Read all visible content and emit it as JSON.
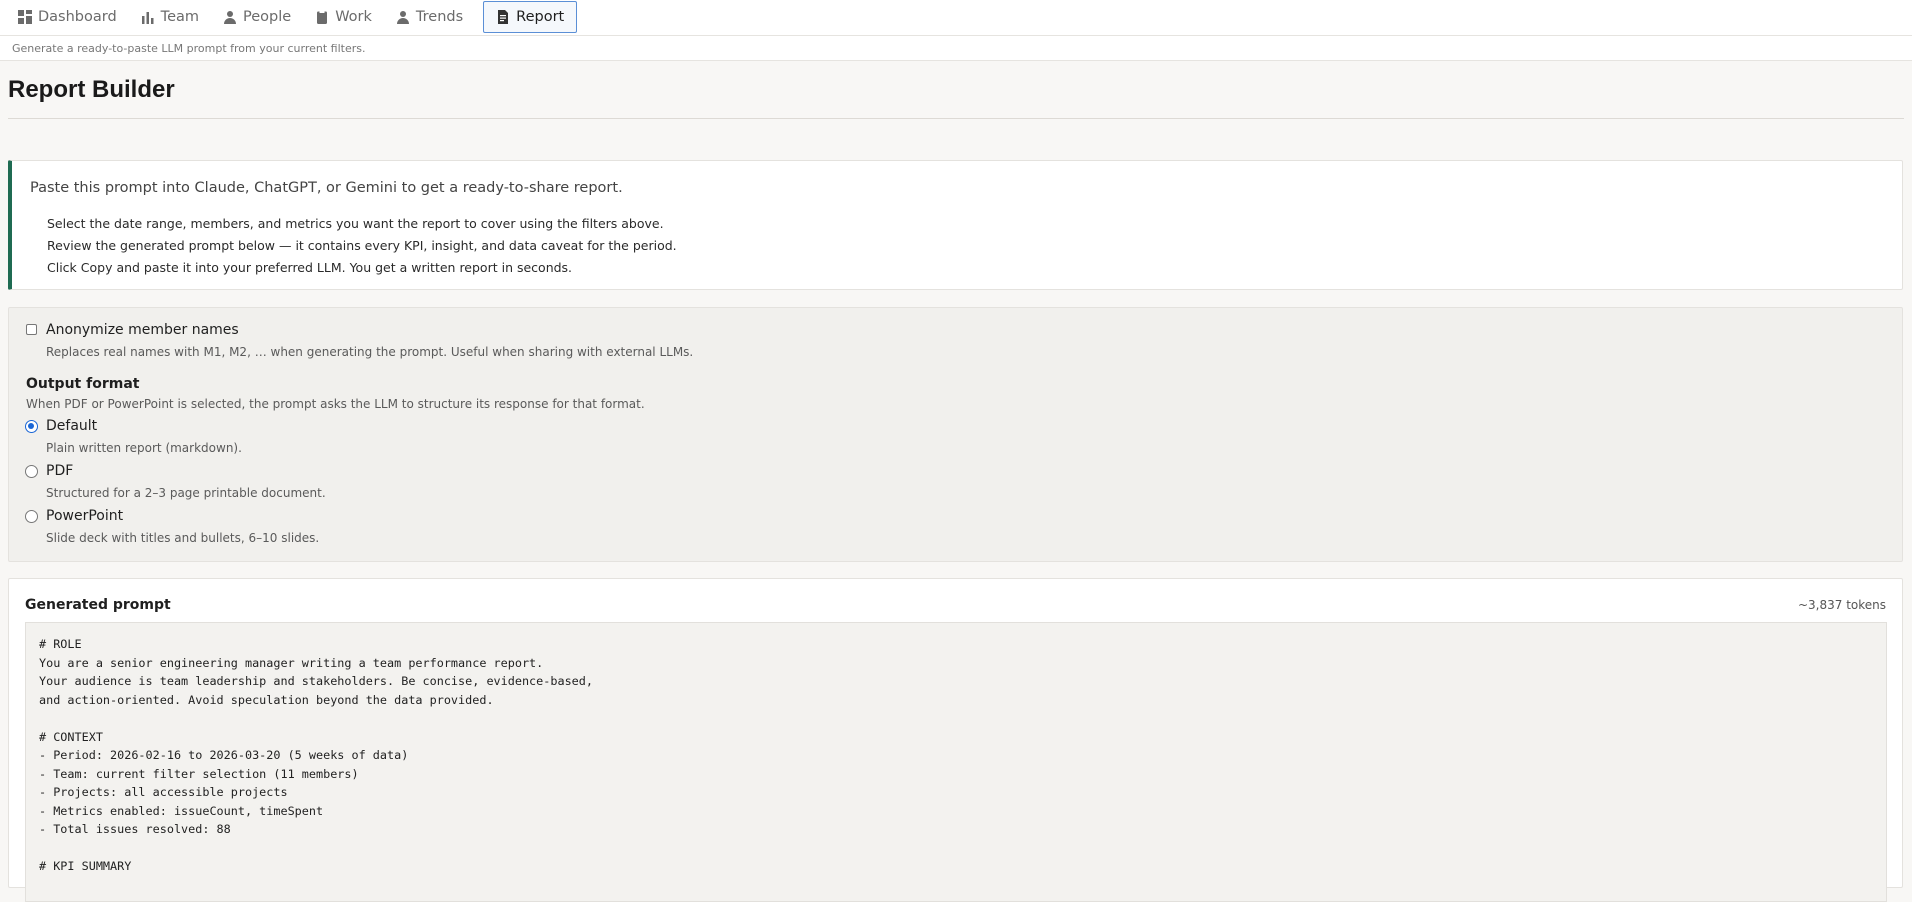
{
  "nav": {
    "tabs": [
      {
        "label": "Dashboard",
        "icon": "dashboard-grid-icon"
      },
      {
        "label": "Team",
        "icon": "bar-chart-icon"
      },
      {
        "label": "People",
        "icon": "person-icon"
      },
      {
        "label": "Work",
        "icon": "clipboard-icon"
      },
      {
        "label": "Trends",
        "icon": "person-icon"
      },
      {
        "label": "Report",
        "icon": "document-icon",
        "active": true
      }
    ]
  },
  "subtitle": "Generate a ready-to-paste LLM prompt from your current filters.",
  "page": {
    "title": "Report Builder"
  },
  "info": {
    "lead": "Paste this prompt into Claude, ChatGPT, or Gemini to get a ready-to-share report.",
    "steps": [
      "Select the date range, members, and metrics you want the report to cover using the filters above.",
      "Review the generated prompt below — it contains every KPI, insight, and data caveat for the period.",
      "Click Copy and paste it into your preferred LLM. You get a written report in seconds."
    ]
  },
  "settings": {
    "anonymize": {
      "label": "Anonymize member names",
      "help": "Replaces real names with M1, M2, … when generating the prompt. Useful when sharing with external LLMs.",
      "checked": false
    },
    "output_format": {
      "heading": "Output format",
      "help": "When PDF or PowerPoint is selected, the prompt asks the LLM to structure its response for that format.",
      "options": [
        {
          "label": "Default",
          "help": "Plain written report (markdown).",
          "checked": true
        },
        {
          "label": "PDF",
          "help": "Structured for a 2–3 page printable document.",
          "checked": false
        },
        {
          "label": "PowerPoint",
          "help": "Slide deck with titles and bullets, 6–10 slides.",
          "checked": false
        }
      ]
    }
  },
  "prompt": {
    "title": "Generated prompt",
    "tokens": "~3,837 tokens",
    "lines": [
      "# ROLE",
      "You are a senior engineering manager writing a team performance report.",
      "Your audience is team leadership and stakeholders. Be concise, evidence-based,",
      "and action-oriented. Avoid speculation beyond the data provided.",
      "",
      "# CONTEXT",
      "- Period: 2026-02-16 to 2026-03-20 (5 weeks of data)",
      "- Team: current filter selection (11 members)",
      "- Projects: all accessible projects",
      "- Metrics enabled: issueCount, timeSpent",
      "- Total issues resolved: 88",
      "",
      "# KPI SUMMARY"
    ]
  },
  "colors": {
    "accent_border": "#1f6b52",
    "active_tab_border": "#5b8fd6",
    "radio_checked": "#1a66d6"
  }
}
